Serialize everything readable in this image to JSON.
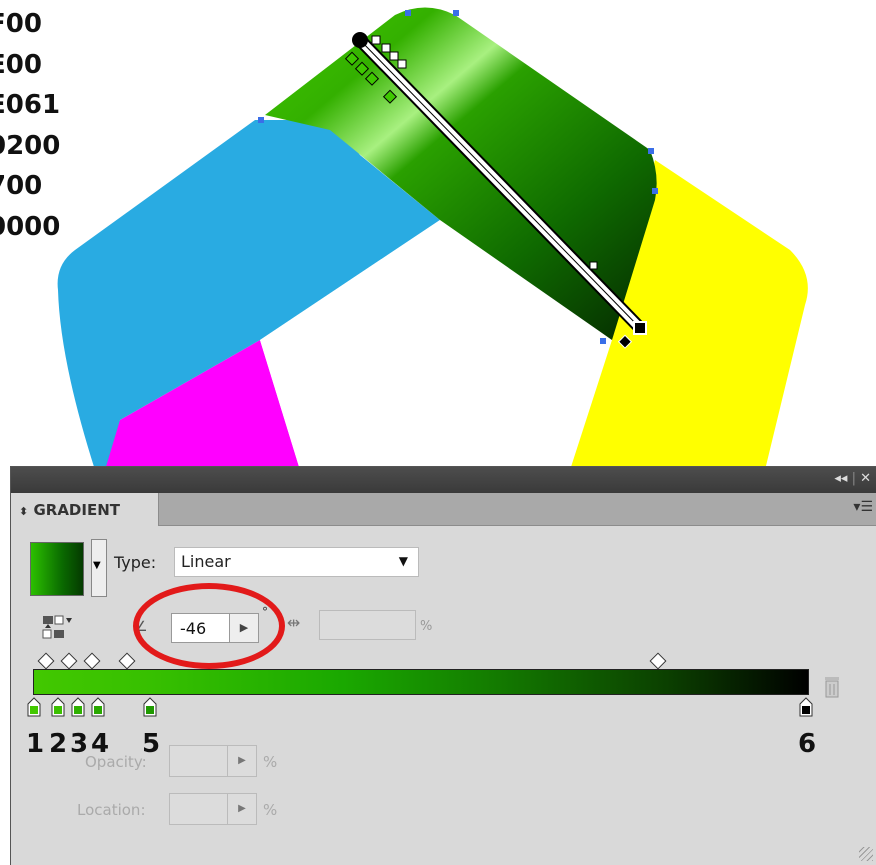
{
  "hex_codes": [
    "F00",
    "E00",
    "E061",
    "0200",
    "700",
    "0000"
  ],
  "colors": {
    "cyan": "#29abe2",
    "magenta": "#ff00ff",
    "yellow": "#ffff00",
    "green_light": "#3ec800",
    "green_dark": "#062800",
    "panel_bg": "#d9d9d9",
    "highlight_circle": "#e21a1a"
  },
  "panel": {
    "tab_label": "GRADIENT",
    "type_label": "Type:",
    "type_value": "Linear",
    "angle_value": "-46",
    "angle_unit": "°",
    "aspect_unit": "%",
    "opacity_label": "Opacity:",
    "opacity_unit": "%",
    "location_label": "Location:",
    "location_unit": "%",
    "collapse_icon": "double-chevron-icon",
    "close_icon": "close-icon",
    "menu_icon": "panel-menu-icon"
  },
  "gradient": {
    "stop_labels": [
      "1",
      "2",
      "3",
      "4",
      "5",
      "6"
    ],
    "stop_locations": [
      0,
      3.3,
      6.6,
      10,
      15,
      100
    ]
  }
}
